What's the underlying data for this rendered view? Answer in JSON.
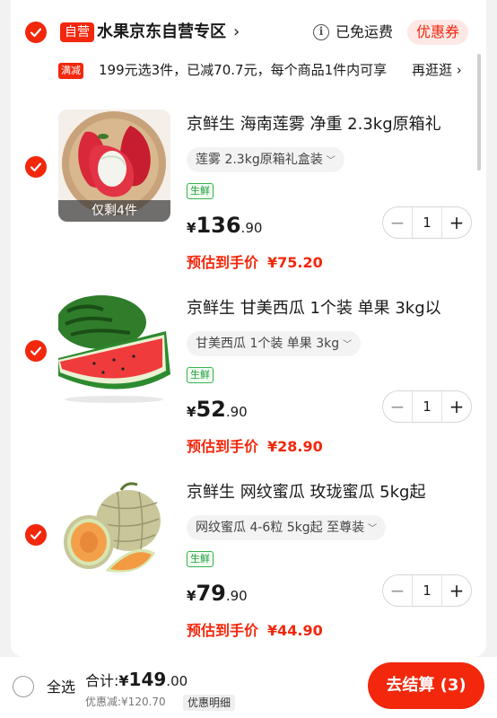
{
  "store": {
    "tag": "自营",
    "name": "水果京东自营专区",
    "chevron": "›",
    "free_shipping": "已免运费",
    "coupon_label": "优惠券"
  },
  "promo": {
    "tag": "满减",
    "text": "199元选3件，已减70.7元，每个商品1件内可享",
    "link": "再逛逛 ›"
  },
  "items": [
    {
      "title": "京鲜生 海南莲雾 净重 2.3kg原箱礼",
      "spec": "莲雾 2.3kg原箱礼盒装",
      "tag": "生鲜",
      "stock_badge": "仅剩4件",
      "currency": "¥",
      "price_int": "136",
      "price_dec": ".90",
      "quantity": "1",
      "est_label": "预估到手价",
      "est_price": "¥75.20",
      "checked": true
    },
    {
      "title": "京鲜生 甘美西瓜 1个装 单果 3kg以",
      "spec": "甘美西瓜 1个装 单果 3kg",
      "tag": "生鲜",
      "currency": "¥",
      "price_int": "52",
      "price_dec": ".90",
      "quantity": "1",
      "est_label": "预估到手价",
      "est_price": "¥28.90",
      "checked": true
    },
    {
      "title": "京鲜生 网纹蜜瓜 玫珑蜜瓜 5kg起",
      "spec": "网纹蜜瓜 4-6粒 5kg起 至尊装",
      "tag": "生鲜",
      "currency": "¥",
      "price_int": "79",
      "price_dec": ".90",
      "quantity": "1",
      "est_label": "预估到手价",
      "est_price": "¥44.90",
      "checked": true
    }
  ],
  "stepper": {
    "minus": "−",
    "plus": "+"
  },
  "footer": {
    "select_all": "全选",
    "total_label": "合计:",
    "total_currency": "¥",
    "total_int": "149",
    "total_dec": ".00",
    "discount_text": "优惠减:¥120.70",
    "detail_label": "优惠明细",
    "checkout_label": "去结算 (3)"
  },
  "colors": {
    "accent": "#f2270c",
    "fresh_green": "#1e9e3a",
    "background": "#f2f2f2"
  }
}
